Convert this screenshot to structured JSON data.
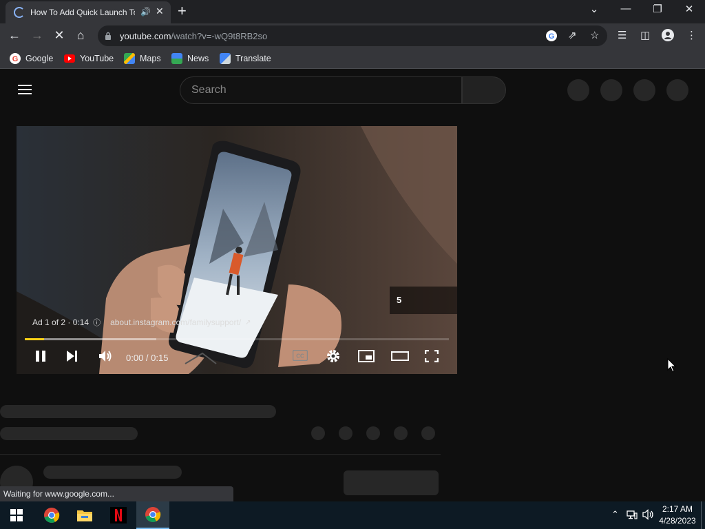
{
  "browser": {
    "tab_title": "How To Add Quick Launch To",
    "new_tab_label": "+",
    "url_host": "youtube.com",
    "url_path": "/watch?v=-wQ9t8RB2so"
  },
  "bookmarks": [
    {
      "label": "Google",
      "icon": "google-icon"
    },
    {
      "label": "YouTube",
      "icon": "youtube-icon"
    },
    {
      "label": "Maps",
      "icon": "maps-icon"
    },
    {
      "label": "News",
      "icon": "news-icon"
    },
    {
      "label": "Translate",
      "icon": "translate-icon"
    }
  ],
  "youtube": {
    "search_placeholder": "Search"
  },
  "player": {
    "ad_info": "Ad 1 of 2 · 0:14",
    "ad_link": "about.instagram.com/familysupport/",
    "skip_countdown": "5",
    "time": "0:00 / 0:15",
    "played_fraction": 0.045,
    "buffered_fraction": 0.31
  },
  "status": {
    "text": "Waiting for www.google.com..."
  },
  "taskbar": {
    "time": "2:17 AM",
    "date": "4/28/2023",
    "accent": "#76b9ed"
  },
  "colors": {
    "ad_progress": "#fcd116",
    "page_bg": "#0f0f0f",
    "skeleton": "#272727"
  }
}
